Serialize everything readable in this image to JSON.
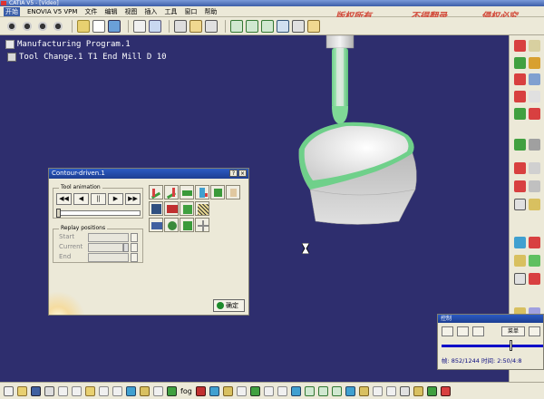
{
  "window": {
    "title": "CATIA V5 - [Video]"
  },
  "menu": {
    "items": [
      "开始",
      "ENOVIA V5 VPM",
      "文件",
      "编辑",
      "视图",
      "插入",
      "工具",
      "窗口",
      "帮助"
    ]
  },
  "watermarks": [
    "版权所有",
    "不得翻录",
    "侵权必究"
  ],
  "tree": {
    "root": "Manufacturing Program.1",
    "child": "Tool Change.1  T1 End Mill D 10"
  },
  "dialog": {
    "title": "Contour-driven.1",
    "help_btn": "?",
    "close_btn": "×",
    "tool_animation": {
      "label": "Tool animation",
      "buttons": [
        "◀◀",
        "◀",
        "||",
        "▶",
        "▶▶"
      ],
      "slider_value": 0
    },
    "replay": {
      "label": "Replay positions",
      "start_label": "Start",
      "current_label": "Current",
      "end_label": "End"
    },
    "ok_label": "确定"
  },
  "control_panel": {
    "title": "控制",
    "menu_btn": "菜单",
    "status": "帧: 852/1244 时间: 2:50/4:8",
    "progress": 0.685
  },
  "bottom_toolbar": {
    "fog_label": "fog"
  },
  "colors": {
    "background": "#2e2e6e",
    "tool_green": "#8fe0a0",
    "toolbar": "#ece9d8"
  }
}
